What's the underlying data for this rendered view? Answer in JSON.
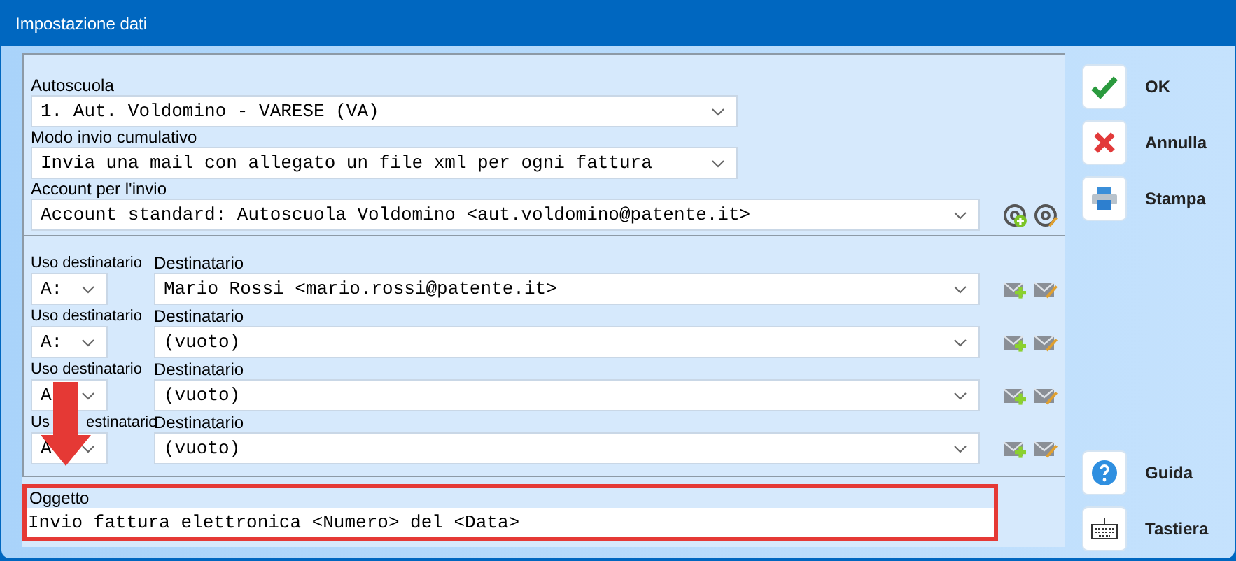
{
  "window": {
    "title": "Impostazione dati"
  },
  "autoscuola": {
    "label": "Autoscuola",
    "value": "1. Aut. Voldomino - VARESE (VA)"
  },
  "modo_invio": {
    "label": "Modo invio cumulativo",
    "value": "Invia una mail con allegato un file xml per ogni fattura"
  },
  "account": {
    "label": "Account per l'invio",
    "value": "Account standard: Autoscuola Voldomino <aut.voldomino@patente.it>"
  },
  "recipients": [
    {
      "usage_label": [
        "Uso destinatario"
      ],
      "usage": "A:",
      "recipient_label": "Destinatario",
      "recipient": "Mario Rossi <mario.rossi@patente.it>"
    },
    {
      "usage_label": [
        "Uso destinatario"
      ],
      "usage": "A:",
      "recipient_label": "Destinatario",
      "recipient": "(vuoto)"
    },
    {
      "usage_label": [
        "Uso destinatario"
      ],
      "usage": "A",
      "recipient_label": "Destinatario",
      "recipient": "(vuoto)"
    },
    {
      "usage_label": [
        "Us",
        "estinatario"
      ],
      "usage": "A",
      "recipient_label": "Destinatario",
      "recipient": "(vuoto)"
    }
  ],
  "subject": {
    "label": "Oggetto",
    "value": "Invio fattura elettronica <Numero> del <Data>",
    "highlighted": true,
    "pointer_arrow": true
  },
  "buttons_top": [
    {
      "label": "OK",
      "kind": "ok"
    },
    {
      "label": "Annulla",
      "kind": "cancel"
    },
    {
      "label": "Stampa",
      "kind": "print"
    }
  ],
  "buttons_bottom": [
    {
      "label": "Guida",
      "kind": "help"
    },
    {
      "label": "Tastiera",
      "kind": "keyboard"
    }
  ]
}
